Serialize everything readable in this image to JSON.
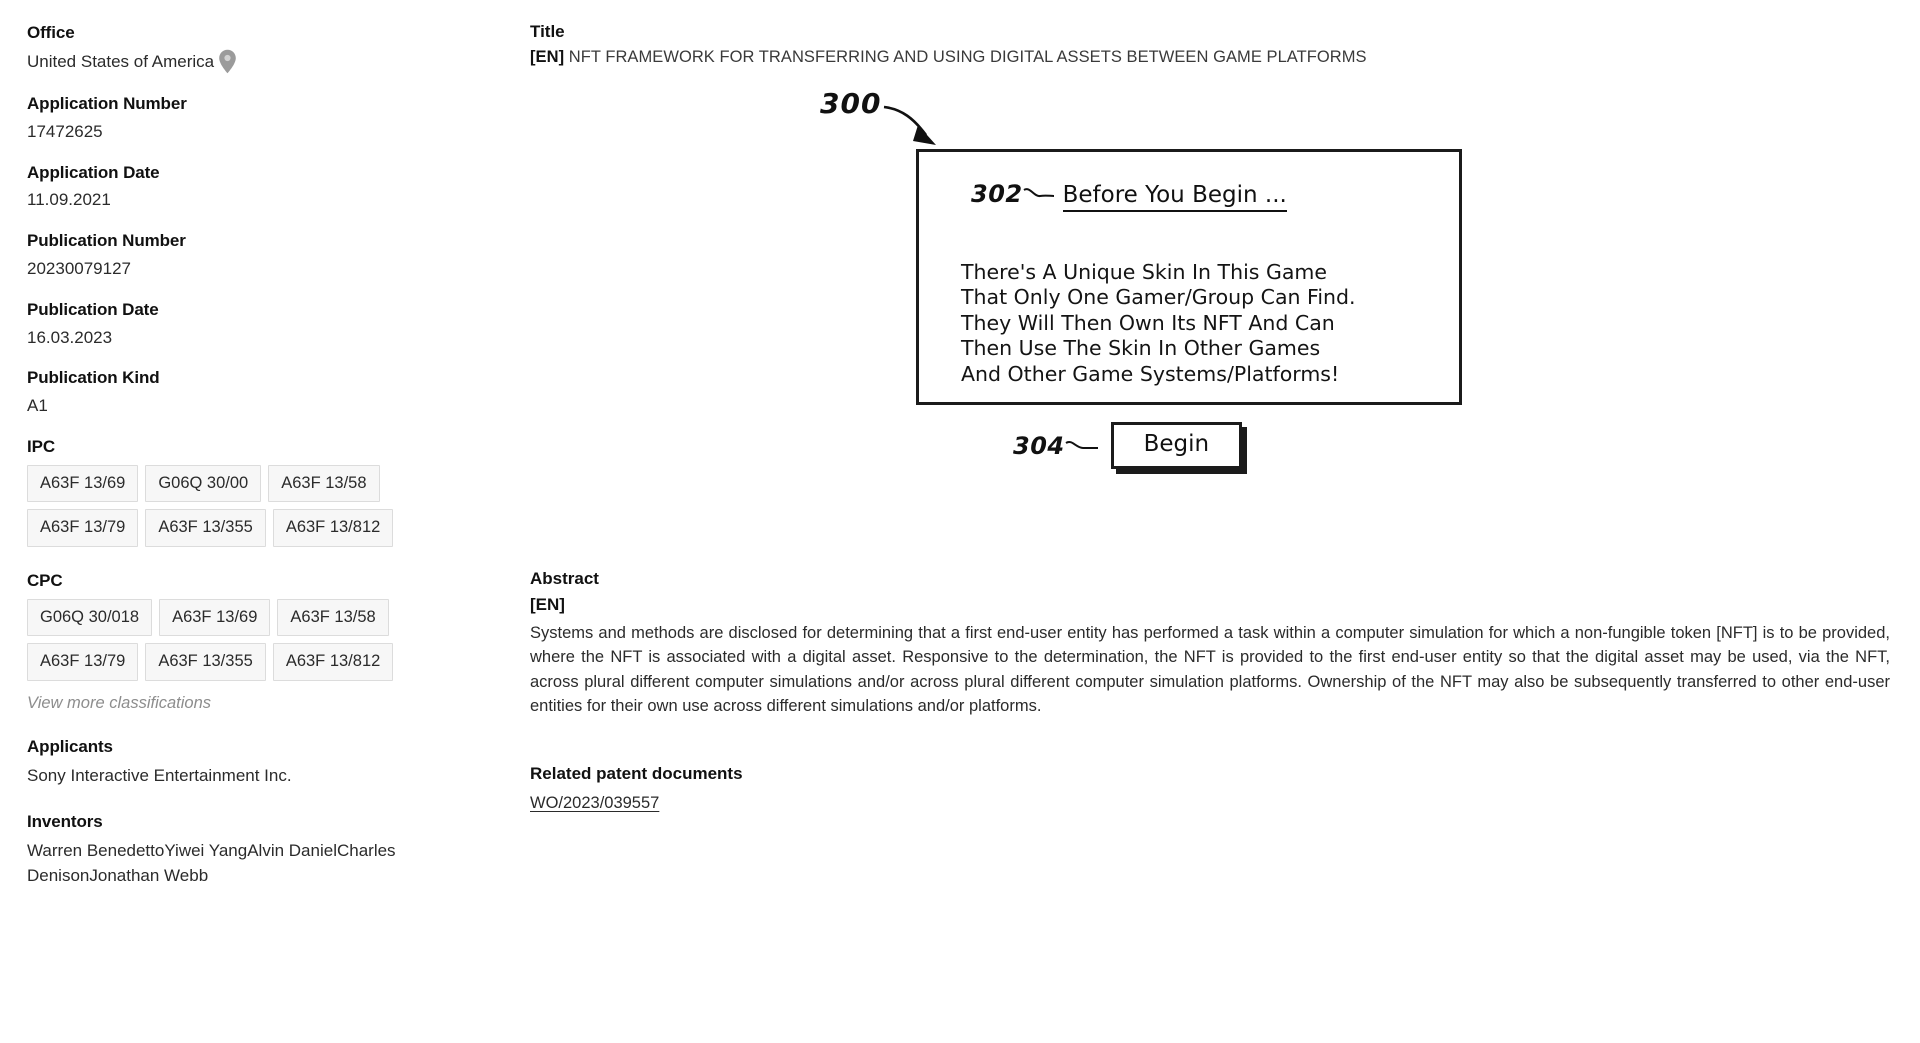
{
  "sidebar": {
    "office": {
      "label": "Office",
      "value": "United States of America",
      "icon": "map-pin-icon"
    },
    "application_number": {
      "label": "Application Number",
      "value": "17472625"
    },
    "application_date": {
      "label": "Application Date",
      "value": "11.09.2021"
    },
    "publication_number": {
      "label": "Publication Number",
      "value": "20230079127"
    },
    "publication_date": {
      "label": "Publication Date",
      "value": "16.03.2023"
    },
    "publication_kind": {
      "label": "Publication Kind",
      "value": "A1"
    },
    "ipc": {
      "label": "IPC",
      "tags": [
        "A63F 13/69",
        "G06Q 30/00",
        "A63F 13/58",
        "A63F 13/79",
        "A63F 13/355",
        "A63F 13/812"
      ]
    },
    "cpc": {
      "label": "CPC",
      "tags": [
        "G06Q 30/018",
        "A63F 13/69",
        "A63F 13/58",
        "A63F 13/79",
        "A63F 13/355",
        "A63F 13/812"
      ]
    },
    "view_more": "View more classifications",
    "applicants": {
      "label": "Applicants",
      "values": [
        "Sony Interactive Entertainment Inc."
      ]
    },
    "inventors": {
      "label": "Inventors",
      "values": [
        "Warren Benedetto",
        "Yiwei Yang",
        "Alvin Daniel",
        "Charles Denison",
        "Jonathan Webb"
      ]
    }
  },
  "main": {
    "title": {
      "label": "Title",
      "lang": "[EN]",
      "text": "NFT FRAMEWORK FOR TRANSFERRING AND USING DIGITAL ASSETS BETWEEN GAME PLATFORMS"
    },
    "figure": {
      "ref_main": "300",
      "ref_heading": "302",
      "heading": "Before You Begin ...",
      "body": "There's A Unique Skin In This Game\nThat Only One Gamer/Group Can Find.\nThey Will Then Own Its NFT And Can\nThen Use The Skin In Other Games\nAnd Other Game Systems/Platforms!",
      "ref_button": "304",
      "button_label": "Begin"
    },
    "abstract": {
      "label": "Abstract",
      "lang": "[EN]",
      "text": "Systems and methods are disclosed for determining that a first end-user entity has performed a task within a computer simulation for which a non-fungible token [NFT] is to be provided, where the NFT is associated with a digital asset. Responsive to the determination, the NFT is provided to the first end-user entity so that the digital asset may be used, via the NFT, across plural different computer simulations and/or across plural different computer simulation platforms. Ownership of the NFT may also be subsequently transferred to other end-user entities for their own use across different simulations and/or platforms."
    },
    "related": {
      "label": "Related patent documents",
      "links": [
        "WO/2023/039557"
      ]
    }
  },
  "colors": {
    "text_primary": "#111111",
    "text_secondary": "#2b2b2b",
    "muted": "#8d8d8d",
    "tag_bg": "#f7f7f7",
    "tag_border": "#dcdcdc",
    "pin": "#9b9b9b",
    "figure_stroke": "#1b1b1b"
  }
}
